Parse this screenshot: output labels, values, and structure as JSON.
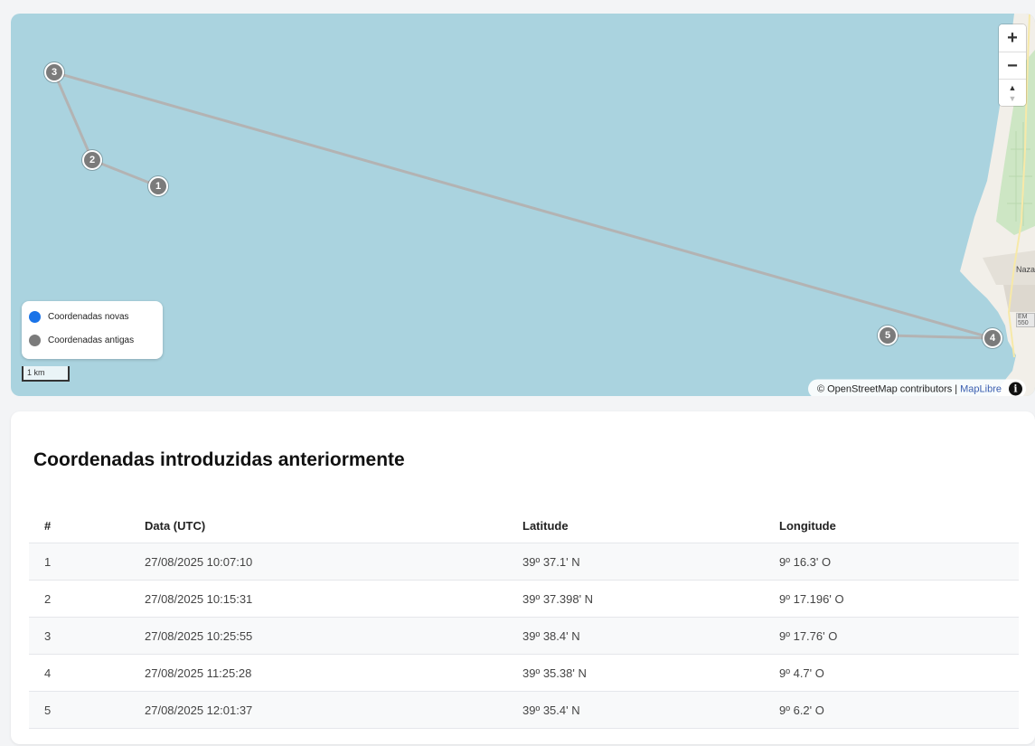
{
  "map": {
    "markers": [
      {
        "label": "1"
      },
      {
        "label": "2"
      },
      {
        "label": "3"
      },
      {
        "label": "4"
      },
      {
        "label": "5"
      }
    ],
    "zoom_in_label": "+",
    "zoom_out_label": "−",
    "compass_label": "▲",
    "legend": {
      "new_label": "Coordenadas novas",
      "new_color": "#1a73e8",
      "old_label": "Coordenadas antigas",
      "old_color": "#7b7b7b"
    },
    "scale_label": "1 km",
    "attribution": {
      "osm": "© OpenStreetMap contributors",
      "separator": "|",
      "maplibre": "MapLibre"
    },
    "place_label": "Naza",
    "road_label": "EM 550",
    "colors": {
      "water": "#aad3df",
      "route": "#b3b3b3",
      "marker": "#7b7b7b"
    }
  },
  "table": {
    "title": "Coordenadas introduzidas anteriormente",
    "headers": [
      "#",
      "Data (UTC)",
      "Latitude",
      "Longitude"
    ],
    "rows": [
      [
        "1",
        "27/08/2025 10:07:10",
        "39º 37.1' N",
        "9º 16.3' O"
      ],
      [
        "2",
        "27/08/2025 10:15:31",
        "39º 37.398' N",
        "9º 17.196' O"
      ],
      [
        "3",
        "27/08/2025 10:25:55",
        "39º 38.4' N",
        "9º 17.76' O"
      ],
      [
        "4",
        "27/08/2025 11:25:28",
        "39º 35.38' N",
        "9º 4.7' O"
      ],
      [
        "5",
        "27/08/2025 12:01:37",
        "39º 35.4' N",
        "9º 6.2' O"
      ]
    ]
  }
}
